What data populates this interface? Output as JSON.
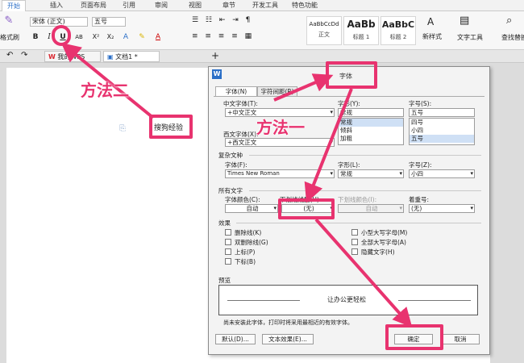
{
  "tabs": {
    "start": "开始",
    "insert": "插入",
    "layout": "页面布局",
    "ref": "引用",
    "review": "审阅",
    "view": "视图",
    "chapter": "章节",
    "dev": "开发工具",
    "special": "特色功能"
  },
  "ribbon": {
    "format_brush": "格式刷",
    "font_name": "宋体 (正文)",
    "font_size": "五号",
    "bold": "B",
    "italic": "I",
    "underline": "U",
    "ab": "AB",
    "sup": "X²",
    "sub": "X₂",
    "styles": [
      {
        "sample": "AaBbCcDd",
        "name": "正文"
      },
      {
        "sample": "AaBb",
        "name": "标题 1"
      },
      {
        "sample": "AaBbC",
        "name": "标题 2"
      }
    ],
    "new_style": "新样式",
    "text_tools": "文字工具",
    "find_replace": "查找替换"
  },
  "docbar": {
    "tab1": "我的WPS",
    "tab2": "文档1 *",
    "new_tab": "+"
  },
  "callout": {
    "sougou": "搜狗经验",
    "method2": "方法二",
    "method1": "方法一"
  },
  "dialog": {
    "title": "字体",
    "tab_font": "字体(N)",
    "tab_spacing": "字符间距(R)",
    "cn_font_label": "中文字体(T):",
    "cn_font_value": "+中文正文",
    "style_label": "字形(Y):",
    "style_value": "常规",
    "style_list": [
      "常规",
      "倾斜",
      "加粗"
    ],
    "size_label": "字号(S):",
    "size_value": "五号",
    "size_list": [
      "四号",
      "小四",
      "五号"
    ],
    "west_font_label": "西文字体(X):",
    "west_font_value": "+西文正文",
    "complex_title": "复杂文种",
    "complex_font_label": "字体(F):",
    "complex_font_value": "Times New Roman",
    "complex_style_label": "字形(L):",
    "complex_style_value": "常规",
    "complex_size_label": "字号(Z):",
    "complex_size_value": "小四",
    "all_text_title": "所有文字",
    "color_label": "字体颜色(C):",
    "color_value": "自动",
    "underline_label": "下划线线型(U):",
    "underline_value": "(无)",
    "underline_color_label": "下划线颜色(I):",
    "underline_color_value": "自动",
    "emphasis_label": "着重号:",
    "emphasis_value": "(无)",
    "effects_title": "效果",
    "effects_left": [
      "删除线(K)",
      "双删除线(G)",
      "上标(P)",
      "下标(B)"
    ],
    "effects_right": [
      "小型大写字母(M)",
      "全部大写字母(A)",
      "隐藏文字(H)"
    ],
    "preview_title": "预览",
    "preview_text": "让办公更轻松",
    "preview_note": "尚未安装此字体，打印时将采用最相近的有效字体。",
    "default_btn": "默认(D)...",
    "text_effect_btn": "文本效果(E)...",
    "ok_btn": "确定",
    "cancel_btn": "取消"
  },
  "colors": {
    "accent": "#e8336f",
    "title_blue": "#2b6fc7"
  }
}
